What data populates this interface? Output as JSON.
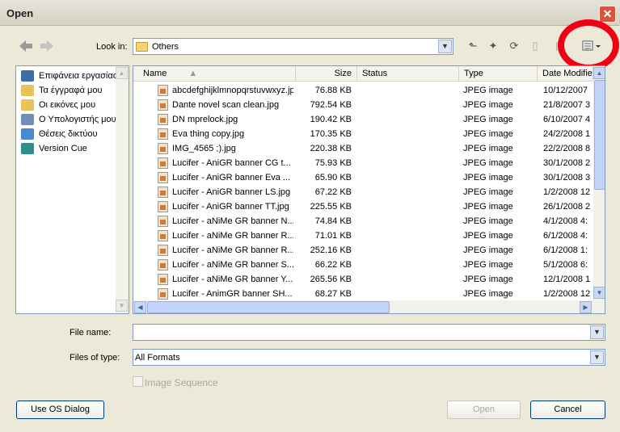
{
  "window": {
    "title": "Open"
  },
  "top_bar": {
    "look_in_label": "Look in:",
    "look_in_value": "Others"
  },
  "places": [
    {
      "label": "Επιφάνεια εργασίας",
      "icon": "desktop-icon",
      "color": "#3a6ea5"
    },
    {
      "label": "Τα έγγραφά μου",
      "icon": "my-documents-icon",
      "color": "#e8c35a"
    },
    {
      "label": "Οι εικόνες μου",
      "icon": "my-pictures-icon",
      "color": "#e8c35a"
    },
    {
      "label": "Ο Υπολογιστής μου",
      "icon": "my-computer-icon",
      "color": "#6f8fb5"
    },
    {
      "label": "Θέσεις δικτύου",
      "icon": "network-places-icon",
      "color": "#4a8bd0"
    },
    {
      "label": "Version Cue",
      "icon": "version-cue-icon",
      "color": "#2f8e8e"
    }
  ],
  "columns": {
    "name": "Name",
    "size": "Size",
    "status": "Status",
    "type": "Type",
    "date": "Date Modified"
  },
  "files": [
    {
      "name": "abcdefghijklmnopqrstuvwxyz.jpg",
      "size": "76.88 KB",
      "type": "JPEG image",
      "date": "10/12/2007"
    },
    {
      "name": "Dante novel scan clean.jpg",
      "size": "792.54 KB",
      "type": "JPEG image",
      "date": "21/8/2007 3"
    },
    {
      "name": "DN mprelock.jpg",
      "size": "190.42 KB",
      "type": "JPEG image",
      "date": "6/10/2007 4"
    },
    {
      "name": "Eva thing copy.jpg",
      "size": "170.35 KB",
      "type": "JPEG image",
      "date": "24/2/2008 1"
    },
    {
      "name": "IMG_4565 ;).jpg",
      "size": "220.38 KB",
      "type": "JPEG image",
      "date": "22/2/2008 8"
    },
    {
      "name": "Lucifer - AniGR banner CG t...",
      "size": "75.93 KB",
      "type": "JPEG image",
      "date": "30/1/2008 2"
    },
    {
      "name": "Lucifer - AniGR banner Eva ...",
      "size": "65.90 KB",
      "type": "JPEG image",
      "date": "30/1/2008 3"
    },
    {
      "name": "Lucifer - AniGR banner LS.jpg",
      "size": "67.22 KB",
      "type": "JPEG image",
      "date": "1/2/2008 12"
    },
    {
      "name": "Lucifer - AniGR banner TT.jpg",
      "size": "225.55 KB",
      "type": "JPEG image",
      "date": "26/1/2008 2"
    },
    {
      "name": "Lucifer - aNiMe GR banner N...",
      "size": "74.84 KB",
      "type": "JPEG image",
      "date": "4/1/2008 4:"
    },
    {
      "name": "Lucifer - aNiMe GR banner R...",
      "size": "71.01 KB",
      "type": "JPEG image",
      "date": "6/1/2008 4:"
    },
    {
      "name": "Lucifer - aNiMe GR banner R...",
      "size": "252.16 KB",
      "type": "JPEG image",
      "date": "6/1/2008 1:"
    },
    {
      "name": "Lucifer - aNiMe GR banner S...",
      "size": "66.22 KB",
      "type": "JPEG image",
      "date": "5/1/2008 6:"
    },
    {
      "name": "Lucifer - aNiMe GR banner Y...",
      "size": "265.56 KB",
      "type": "JPEG image",
      "date": "12/1/2008 1"
    },
    {
      "name": "Lucifer - AnimGR banner SH...",
      "size": "68.27 KB",
      "type": "JPEG image",
      "date": "1/2/2008 12"
    }
  ],
  "form": {
    "file_name_label": "File name:",
    "file_name_value": "",
    "files_of_type_label": "Files of type:",
    "files_of_type_value": "All Formats",
    "image_sequence_label": "Image Sequence"
  },
  "buttons": {
    "os_dialog": "Use OS Dialog",
    "open": "Open",
    "cancel": "Cancel"
  },
  "colors": {
    "highlight_ring": "#f00015",
    "close_button": "#d8543c"
  }
}
